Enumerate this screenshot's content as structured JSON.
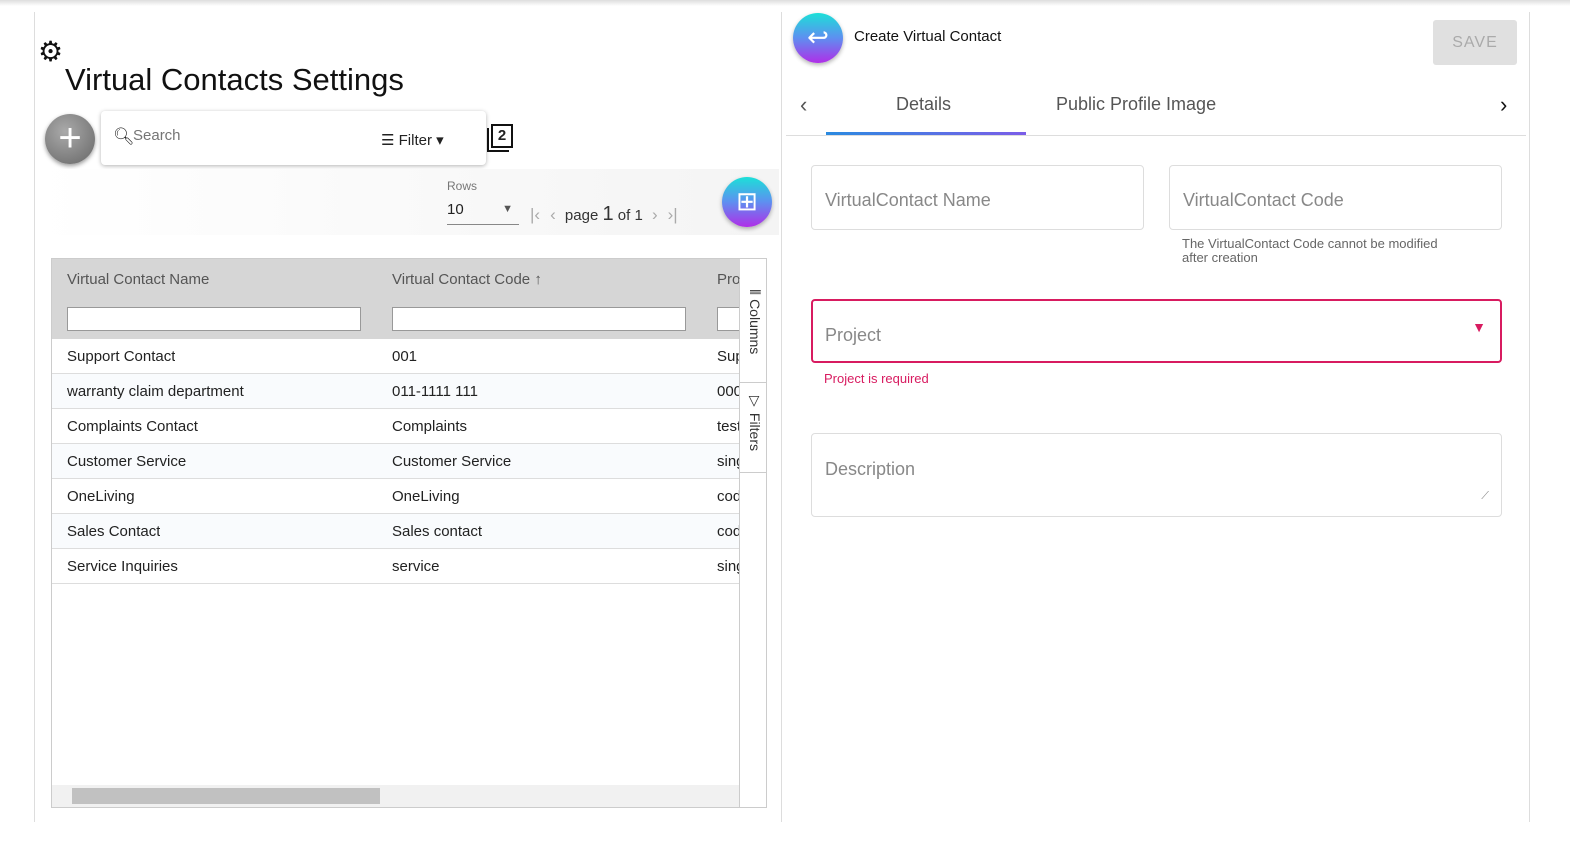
{
  "left": {
    "title": "Virtual Contacts Settings",
    "search_placeholder": "Search",
    "filter_label": "Filter",
    "copy_badge": "2",
    "rows_label": "Rows",
    "rows_value": "10",
    "page_label": "page",
    "page_current": "1",
    "page_of": "of",
    "page_total": "1",
    "columns": [
      "Virtual Contact Name",
      "Virtual Contact Code",
      "Pro"
    ],
    "rows": [
      [
        "Support Contact",
        "001",
        "Sup"
      ],
      [
        "warranty claim department",
        "011-1111 111",
        "000"
      ],
      [
        "Complaints Contact",
        "Complaints",
        "test"
      ],
      [
        "Customer Service",
        "Customer Service",
        "sing"
      ],
      [
        "OneLiving",
        "OneLiving",
        "cod"
      ],
      [
        "Sales Contact",
        "Sales contact",
        "cod"
      ],
      [
        "Service Inquiries",
        "service",
        "sing"
      ]
    ],
    "side_tabs": {
      "columns": "Columns",
      "filters": "Filters"
    }
  },
  "right": {
    "title": "Create Virtual Contact",
    "save_label": "SAVE",
    "tabs": [
      "Details",
      "Public Profile Image"
    ],
    "name_placeholder": "VirtualContact Name",
    "code_placeholder": "VirtualContact Code",
    "code_hint": "The VirtualContact Code cannot be modified after creation",
    "project_placeholder": "Project",
    "project_error": "Project is required",
    "description_placeholder": "Description"
  },
  "colors": {
    "accent": "#7b5de8",
    "error": "#d81b60"
  }
}
